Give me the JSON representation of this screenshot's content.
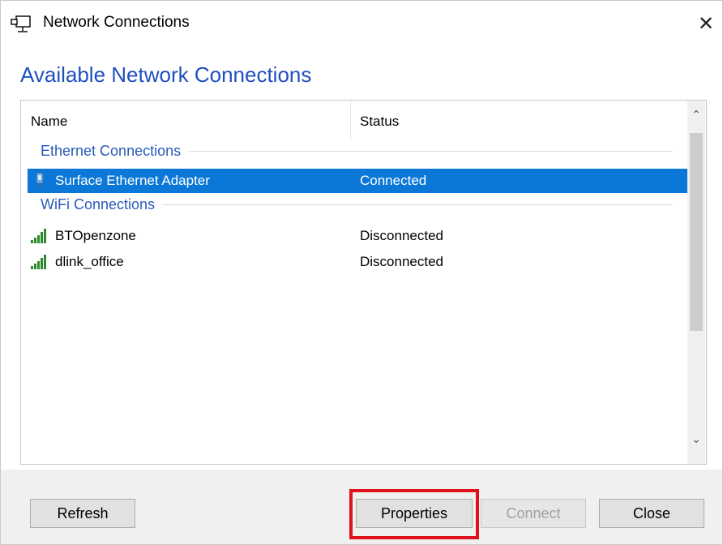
{
  "window": {
    "title": "Network Connections",
    "close_glyph": "✕"
  },
  "heading": "Available Network Connections",
  "list": {
    "columns": {
      "name": "Name",
      "status": "Status"
    },
    "groups": [
      {
        "label": "Ethernet Connections",
        "items": [
          {
            "name": "Surface Ethernet Adapter",
            "status": "Connected",
            "icon": "ethernet-icon",
            "selected": true
          }
        ]
      },
      {
        "label": "WiFi Connections",
        "items": [
          {
            "name": "BTOpenzone",
            "status": "Disconnected",
            "icon": "wifi-signal-icon",
            "selected": false
          },
          {
            "name": "dlink_office",
            "status": "Disconnected",
            "icon": "wifi-signal-icon",
            "selected": false
          }
        ]
      }
    ],
    "scroll_up_glyph": "⌃",
    "scroll_down_glyph": "⌄"
  },
  "buttons": {
    "refresh": "Refresh",
    "properties": "Properties",
    "connect": "Connect",
    "close": "Close"
  },
  "colors": {
    "accent": "#1f4fbf",
    "selection": "#0b78d7",
    "highlight_box": "#e0121b",
    "wifi_green": "#2f8a2f"
  }
}
